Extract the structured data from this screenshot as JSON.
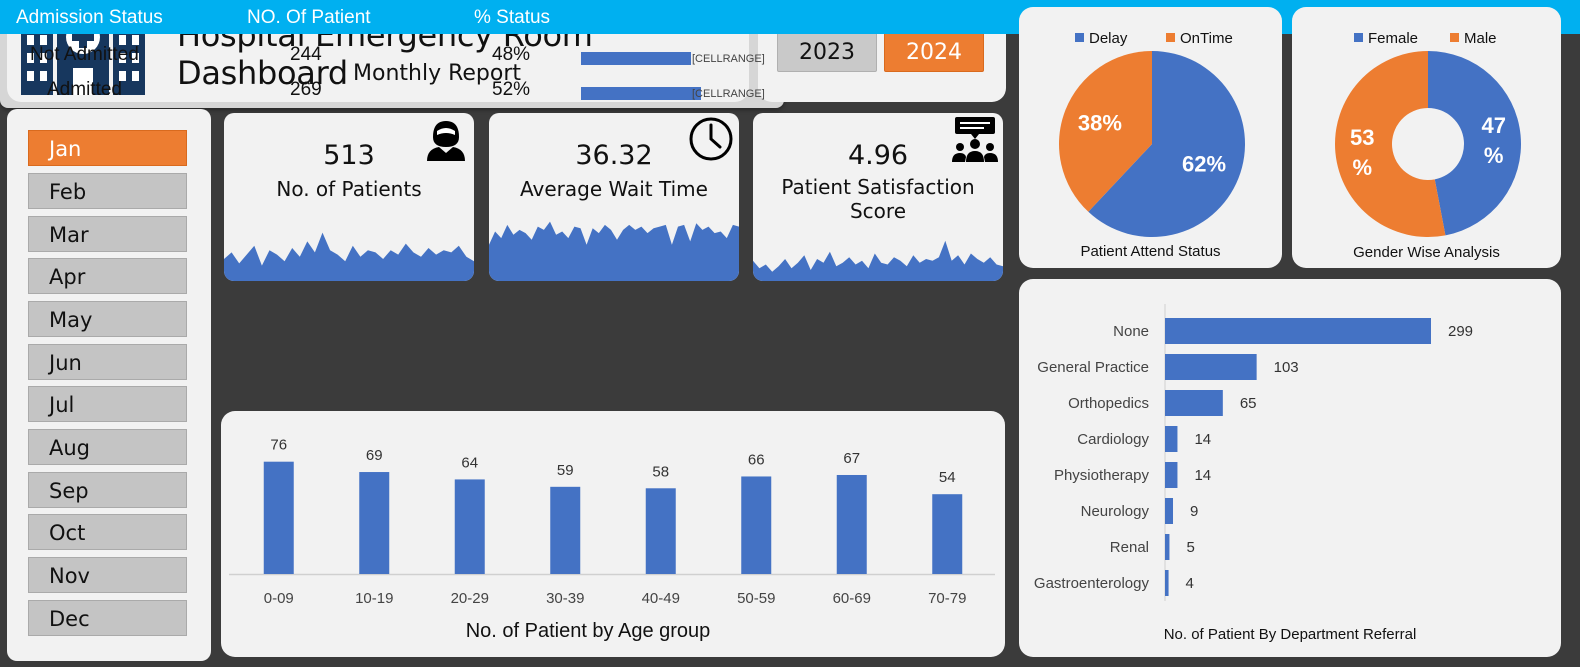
{
  "header": {
    "title": "Hospital Emergency Room Dashboard",
    "subtitle": "Monthly Report"
  },
  "years": {
    "y2023": "2023",
    "y2024": "2024",
    "selected": "2024"
  },
  "months": [
    "Jan",
    "Feb",
    "Mar",
    "Apr",
    "May",
    "Jun",
    "Jul",
    "Aug",
    "Sep",
    "Oct",
    "Nov",
    "Dec"
  ],
  "selected_month": "Jan",
  "kpis": {
    "patients": {
      "value": "513",
      "label": "No. of Patients",
      "icon": "patient-icon"
    },
    "wait": {
      "value": "36.32",
      "label": "Average Wait Time",
      "icon": "clock-icon"
    },
    "satisfaction": {
      "value": "4.96",
      "label": "Patient Satisfaction Score",
      "icon": "group-feedback-icon"
    }
  },
  "admission": {
    "headers": {
      "status": "Admission Status",
      "count": "NO. Of Patient",
      "pct": "% Status"
    },
    "rows": [
      {
        "status": "Not Admitted",
        "count": "244",
        "pct": "48%",
        "fraction": 0.48,
        "cellrange": "[CELLRANGE]"
      },
      {
        "status": "Admitted",
        "count": "269",
        "pct": "52%",
        "fraction": 0.52,
        "cellrange": "[CELLRANGE]"
      }
    ]
  },
  "colors": {
    "blue": "#4472c4",
    "orange": "#ed7d31",
    "cyan": "#00b0f0"
  },
  "chart_data": [
    {
      "id": "attend",
      "type": "pie",
      "title": "Patient Attend Status",
      "legend_position": "top",
      "labels": [
        "Delay",
        "OnTime"
      ],
      "values": [
        62,
        38
      ],
      "value_labels": [
        "62%",
        "38%"
      ],
      "colors": [
        "#4472c4",
        "#ed7d31"
      ]
    },
    {
      "id": "gender",
      "type": "pie",
      "title": "Gender Wise Analysis",
      "legend_position": "top",
      "labels": [
        "Female",
        "Male"
      ],
      "values": [
        47,
        53
      ],
      "value_labels": [
        "47 %",
        "53 %"
      ],
      "colors": [
        "#4472c4",
        "#ed7d31"
      ]
    },
    {
      "id": "age",
      "type": "bar",
      "title": "No. of Patient by Age group",
      "categories": [
        "0-09",
        "10-19",
        "20-29",
        "30-39",
        "40-49",
        "50-59",
        "60-69",
        "70-79"
      ],
      "values": [
        76,
        69,
        64,
        59,
        58,
        66,
        67,
        54
      ],
      "ylim": [
        0,
        90
      ]
    },
    {
      "id": "dept",
      "type": "bar",
      "orientation": "horizontal",
      "title": "No. of Patient By Department Referral",
      "categories": [
        "None",
        "General Practice",
        "Orthopedics",
        "Cardiology",
        "Physiotherapy",
        "Neurology",
        "Renal",
        "Gastroenterology"
      ],
      "values": [
        299,
        103,
        65,
        14,
        14,
        9,
        5,
        4
      ]
    },
    {
      "id": "spark_patients",
      "type": "area",
      "values": [
        10,
        13,
        8,
        12,
        16,
        7,
        14,
        12,
        9,
        15,
        11,
        18,
        13,
        22,
        14,
        12,
        9,
        16,
        11,
        14,
        13,
        10,
        14,
        12,
        17,
        13,
        11,
        15,
        12,
        14,
        13,
        16,
        11,
        9
      ]
    },
    {
      "id": "spark_wait",
      "type": "area",
      "values": [
        22,
        30,
        26,
        34,
        28,
        31,
        29,
        25,
        33,
        31,
        36,
        28,
        30,
        26,
        33,
        32,
        22,
        32,
        29,
        34,
        31,
        25,
        31,
        34,
        31,
        33,
        29,
        32,
        33,
        34,
        22,
        33,
        34,
        24,
        35,
        31,
        33,
        29,
        30,
        26,
        34,
        33
      ]
    },
    {
      "id": "spark_satisfaction",
      "type": "area",
      "values": [
        11,
        7,
        9,
        5,
        8,
        12,
        7,
        10,
        14,
        6,
        12,
        10,
        16,
        8,
        10,
        13,
        9,
        11,
        7,
        15,
        10,
        9,
        13,
        11,
        8,
        14,
        10,
        12,
        11,
        13,
        22,
        11,
        14,
        9,
        15,
        12,
        10,
        13,
        9,
        8
      ]
    }
  ]
}
